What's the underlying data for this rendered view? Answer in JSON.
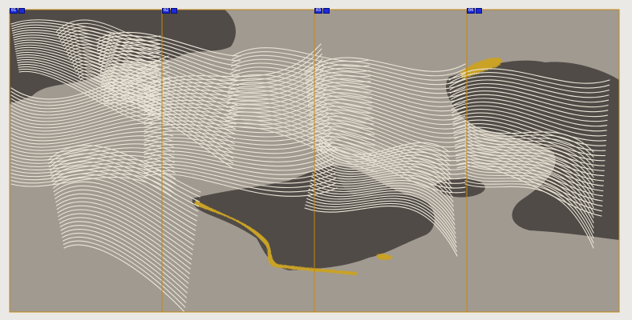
{
  "panels": [
    {
      "number": "01",
      "icon": "panel-icon"
    },
    {
      "number": "02",
      "icon": "panel-icon"
    },
    {
      "number": "03",
      "icon": "panel-icon"
    },
    {
      "number": "04",
      "icon": "panel-icon"
    }
  ],
  "colors": {
    "canvas": "#a19a91",
    "mountain": "#504b47",
    "lines": "#ece6d8",
    "gold": "#c9a227",
    "guide": "#c48a12",
    "marker": "#1c2bd8"
  }
}
